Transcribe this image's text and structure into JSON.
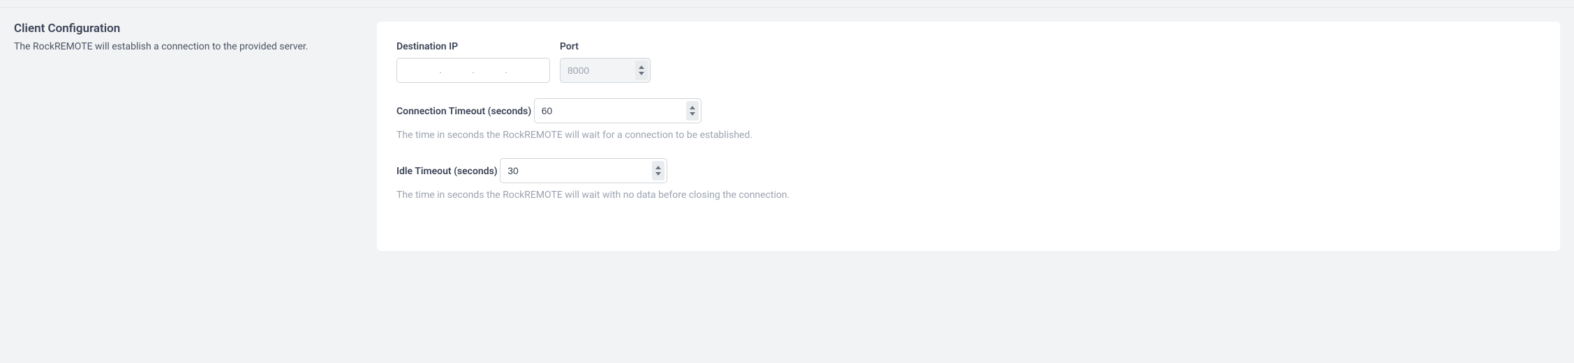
{
  "section": {
    "title": "Client Configuration",
    "description": "The RockREMOTE will establish a connection to the provided server."
  },
  "fields": {
    "destination_ip": {
      "label": "Destination IP",
      "value": "",
      "placeholder": ".       .       ."
    },
    "port": {
      "label": "Port",
      "value": "8000"
    },
    "connection_timeout": {
      "label": "Connection Timeout (seconds)",
      "value": "60",
      "help": "The time in seconds the RockREMOTE will wait for a connection to be established."
    },
    "idle_timeout": {
      "label": "Idle Timeout (seconds)",
      "value": "30",
      "help": "The time in seconds the RockREMOTE will wait with no data before closing the connection."
    }
  }
}
